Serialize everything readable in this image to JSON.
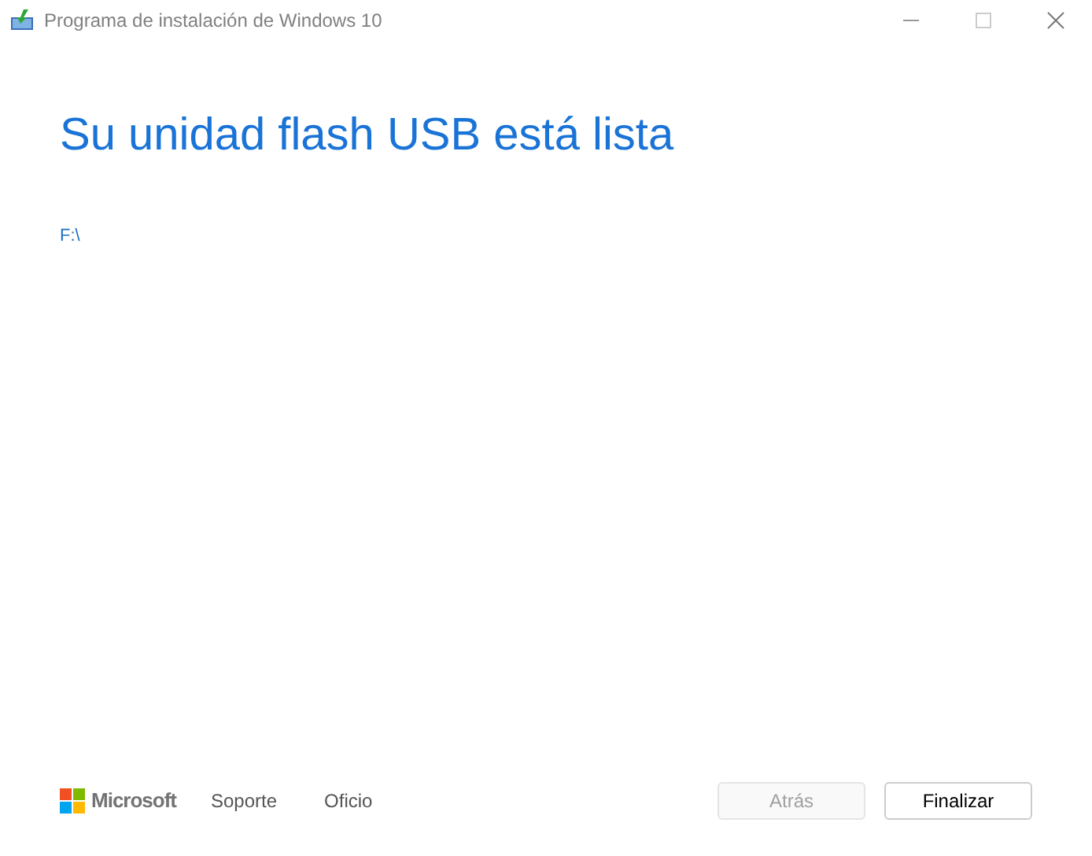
{
  "window": {
    "title": "Programa de instalación de Windows 10"
  },
  "heading": "Su unidad flash USB está lista",
  "drive": "F:\\",
  "footer": {
    "brand": "Microsoft",
    "links": [
      "Soporte",
      "Oficio"
    ]
  },
  "buttons": [
    {
      "label": "Atrás",
      "disabled": true
    },
    {
      "label": "Finalizar",
      "disabled": false
    }
  ]
}
